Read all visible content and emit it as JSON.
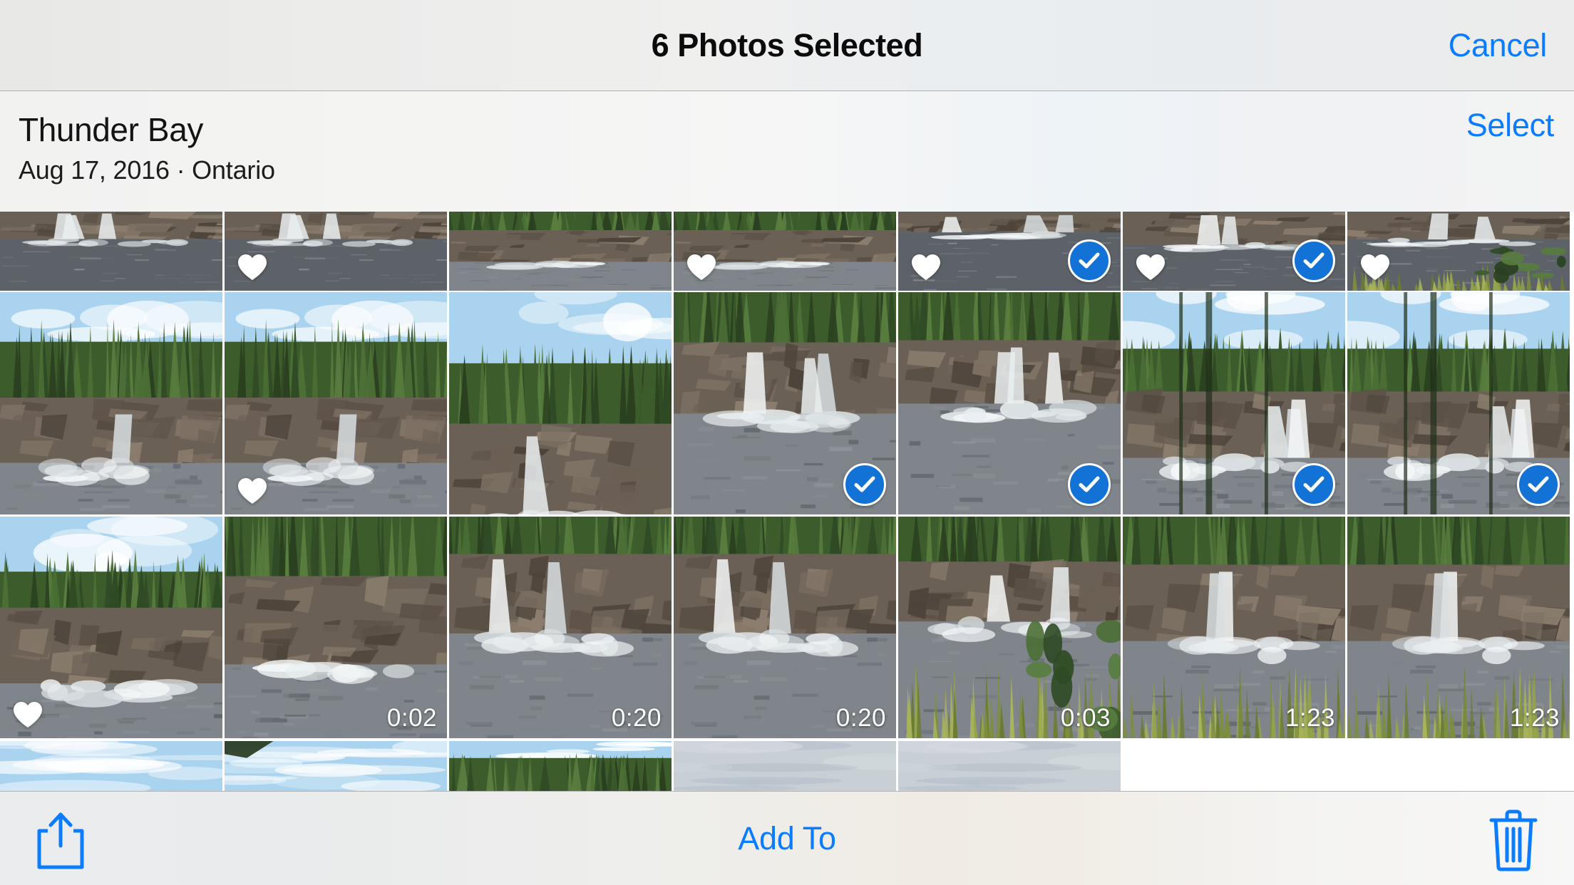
{
  "navbar": {
    "title": "6 Photos Selected",
    "cancel_label": "Cancel"
  },
  "moment": {
    "title": "Thunder Bay",
    "subtitle": "Aug 17, 2016 · Ontario",
    "select_label": "Select"
  },
  "selection": {
    "count": 6,
    "accent_color": "#0a7cff",
    "check_badge_color": "#1272d6"
  },
  "grid": {
    "columns": 7,
    "rows": [
      {
        "row_index": 0,
        "clipped": "top",
        "cells": [
          {
            "id": "r0c0",
            "scene": "waterfall-rapids-dark-water",
            "favorite": false,
            "selected": false,
            "duration": null
          },
          {
            "id": "r0c1",
            "scene": "waterfall-rapids-dark-water",
            "favorite": true,
            "selected": false,
            "duration": null
          },
          {
            "id": "r0c2",
            "scene": "river-rock-ledge-grey-water",
            "favorite": false,
            "selected": false,
            "duration": null
          },
          {
            "id": "r0c3",
            "scene": "river-rock-ledge-grey-water",
            "favorite": true,
            "selected": false,
            "duration": null
          },
          {
            "id": "r0c4",
            "scene": "waterfall-cliff-shadow",
            "favorite": true,
            "selected": true,
            "duration": null
          },
          {
            "id": "r0c5",
            "scene": "waterfall-gorge-forest",
            "favorite": true,
            "selected": true,
            "duration": null
          },
          {
            "id": "r0c6",
            "scene": "rapids-green-shrub",
            "favorite": true,
            "selected": false,
            "duration": null
          }
        ]
      },
      {
        "row_index": 1,
        "clipped": "none",
        "cells": [
          {
            "id": "r1c0",
            "scene": "waterfall-pine-forest-blue-sky",
            "favorite": false,
            "selected": false,
            "duration": null
          },
          {
            "id": "r1c1",
            "scene": "waterfall-pine-forest-blue-sky",
            "favorite": true,
            "selected": false,
            "duration": null
          },
          {
            "id": "r1c2",
            "scene": "waterfall-rock-ledge-forest",
            "favorite": false,
            "selected": false,
            "duration": null
          },
          {
            "id": "r1c3",
            "scene": "waterfall-rock-ledge-bright",
            "favorite": false,
            "selected": true,
            "duration": null
          },
          {
            "id": "r1c4",
            "scene": "waterfall-wide-rock-shelf",
            "favorite": false,
            "selected": true,
            "duration": null
          },
          {
            "id": "r1c5",
            "scene": "waterfall-through-trees-sky",
            "favorite": false,
            "selected": true,
            "duration": null
          },
          {
            "id": "r1c6",
            "scene": "waterfall-through-trees-sky",
            "favorite": false,
            "selected": true,
            "duration": null
          }
        ]
      },
      {
        "row_index": 2,
        "clipped": "none",
        "cells": [
          {
            "id": "r2c0",
            "scene": "river-pool-forest-sky",
            "favorite": true,
            "selected": false,
            "duration": null
          },
          {
            "id": "r2c1",
            "scene": "rock-ledge-river-video",
            "favorite": false,
            "selected": false,
            "duration": "0:02"
          },
          {
            "id": "r2c2",
            "scene": "waterfall-rock-river-video",
            "favorite": false,
            "selected": false,
            "duration": "0:20"
          },
          {
            "id": "r2c3",
            "scene": "waterfall-rock-river-video",
            "favorite": false,
            "selected": false,
            "duration": "0:20"
          },
          {
            "id": "r2c4",
            "scene": "waterfall-green-plant-video",
            "favorite": false,
            "selected": false,
            "duration": "0:03"
          },
          {
            "id": "r2c5",
            "scene": "waterfall-grass-foreground-video",
            "favorite": false,
            "selected": false,
            "duration": "1:23"
          },
          {
            "id": "r2c6",
            "scene": "waterfall-grass-foreground-video",
            "favorite": false,
            "selected": false,
            "duration": "1:23"
          }
        ]
      },
      {
        "row_index": 3,
        "clipped": "bottom",
        "cells": [
          {
            "id": "r3c0",
            "scene": "pine-treeline-sky",
            "favorite": false,
            "selected": false,
            "duration": null
          },
          {
            "id": "r3c1",
            "scene": "blue-sky-clouds-branch",
            "favorite": false,
            "selected": false,
            "duration": null
          },
          {
            "id": "r3c2",
            "scene": "pine-treeline-rock",
            "favorite": false,
            "selected": false,
            "duration": null
          },
          {
            "id": "r3c3",
            "scene": "overcast-cloud-sky",
            "favorite": false,
            "selected": false,
            "duration": null
          },
          {
            "id": "r3c4",
            "scene": "overcast-cloud-sky",
            "favorite": false,
            "selected": false,
            "duration": null
          }
        ]
      }
    ]
  },
  "toolbar": {
    "share_icon": "share-icon",
    "add_to_label": "Add To",
    "trash_icon": "trash-icon"
  }
}
